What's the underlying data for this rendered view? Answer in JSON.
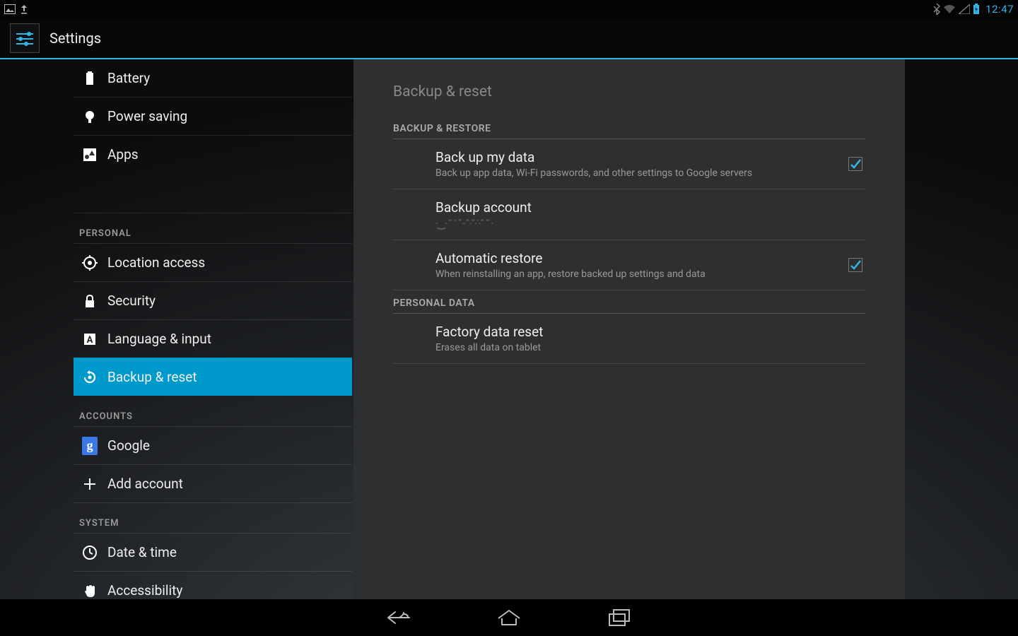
{
  "status": {
    "clock": "12:47"
  },
  "header": {
    "title": "Settings"
  },
  "sidebar": {
    "groups": [
      {
        "header": null,
        "items": [
          {
            "icon": "battery-icon",
            "label": "Battery",
            "selected": false
          },
          {
            "icon": "bulb-icon",
            "label": "Power saving",
            "selected": false
          },
          {
            "icon": "apps-icon",
            "label": "Apps",
            "selected": false
          }
        ]
      },
      {
        "header": "PERSONAL",
        "items": [
          {
            "icon": "location-icon",
            "label": "Location access",
            "selected": false
          },
          {
            "icon": "lock-icon",
            "label": "Security",
            "selected": false
          },
          {
            "icon": "language-icon",
            "label": "Language & input",
            "selected": false
          },
          {
            "icon": "restore-icon",
            "label": "Backup & reset",
            "selected": true
          }
        ]
      },
      {
        "header": "ACCOUNTS",
        "items": [
          {
            "icon": "google-icon",
            "label": "Google",
            "selected": false
          },
          {
            "icon": "plus-icon",
            "label": "Add account",
            "selected": false
          }
        ]
      },
      {
        "header": "SYSTEM",
        "items": [
          {
            "icon": "clock-icon",
            "label": "Date & time",
            "selected": false
          },
          {
            "icon": "hand-icon",
            "label": "Accessibility",
            "selected": false
          }
        ]
      }
    ]
  },
  "detail": {
    "title": "Backup & reset",
    "sections": [
      {
        "header": "BACKUP & RESTORE",
        "rows": [
          {
            "id": "backup-my-data",
            "primary": "Back up my data",
            "secondary": "Back up app data, Wi-Fi passwords, and other settings to Google servers",
            "checkbox": true,
            "checked": true
          },
          {
            "id": "backup-account",
            "primary": "Backup account",
            "secondary_obscured": true,
            "checkbox": false
          },
          {
            "id": "automatic-restore",
            "primary": "Automatic restore",
            "secondary": "When reinstalling an app, restore backed up settings and data",
            "checkbox": true,
            "checked": true
          }
        ]
      },
      {
        "header": "PERSONAL DATA",
        "rows": [
          {
            "id": "factory-data-reset",
            "primary": "Factory data reset",
            "secondary": "Erases all data on tablet",
            "checkbox": false
          }
        ]
      }
    ]
  }
}
